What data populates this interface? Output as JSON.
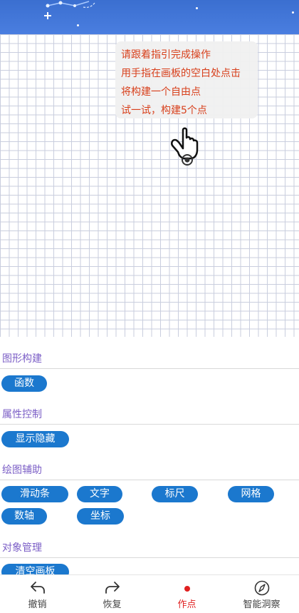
{
  "guide": {
    "lines": [
      "请跟着指引完成操作",
      "用手指在画板的空白处点击",
      "将构建一个自由点",
      "试一试，构建5个点"
    ]
  },
  "sections": [
    {
      "title": "图形构建",
      "buttons": [
        "函数"
      ]
    },
    {
      "title": "属性控制",
      "buttons": [
        "显示隐藏"
      ]
    },
    {
      "title": "绘图辅助",
      "buttons": [
        "滑动条",
        "文字",
        "标尺",
        "网格",
        "数轴",
        "坐标"
      ]
    },
    {
      "title": "对象管理",
      "buttons": [
        "清空画板"
      ]
    }
  ],
  "bottom_nav": {
    "items": [
      "撤销",
      "恢复",
      "作点",
      "智能洞察"
    ],
    "active": "作点"
  },
  "colors": {
    "header": "#3b6fd0",
    "pill": "#1b78ce",
    "section_title": "#7b5ec6",
    "guide_text": "#d8401c",
    "active_tab": "#e02020",
    "grid": "#c9cede"
  },
  "icons": {
    "undo": "undo-icon",
    "redo": "redo-icon",
    "point": "point-dot-icon",
    "insight": "compass-icon",
    "hand": "pointing-hand-icon"
  }
}
